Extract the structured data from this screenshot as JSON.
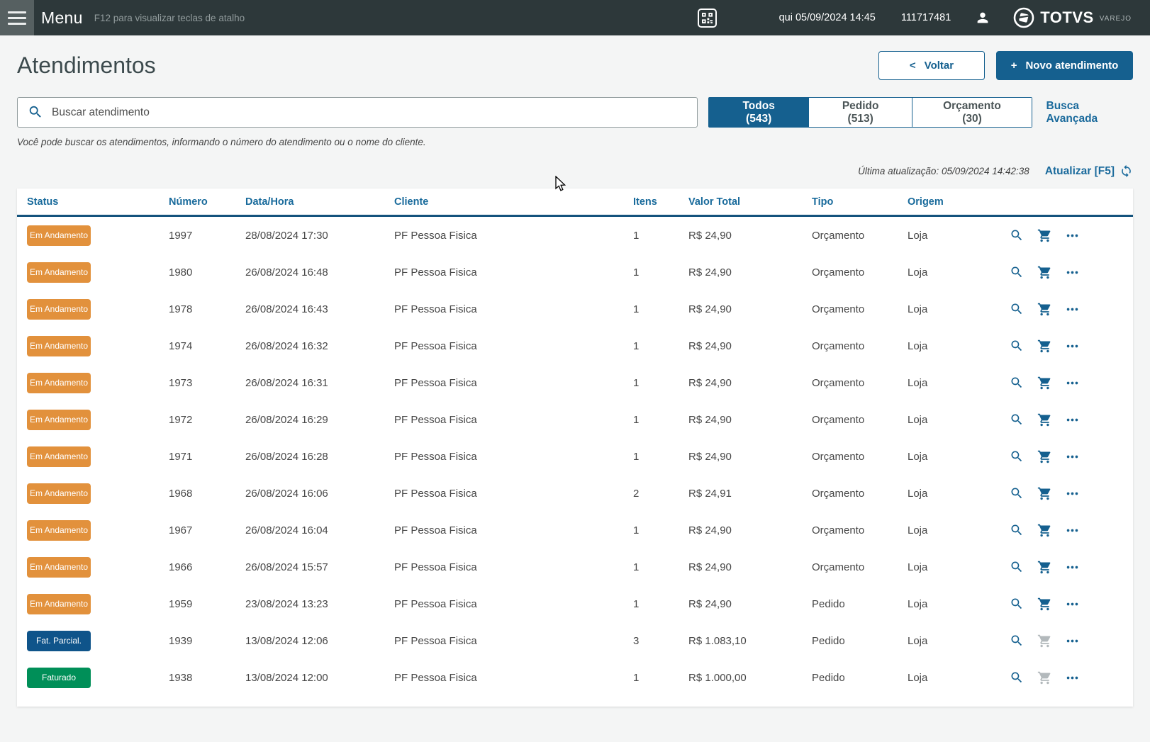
{
  "topbar": {
    "menu_label": "Menu",
    "shortcut_hint": "F12 para visualizar teclas de atalho",
    "datetime": "qui 05/09/2024 14:45",
    "user_code": "111717481",
    "brand": "TOTVS",
    "brand_sub": "VAREJO"
  },
  "header": {
    "title": "Atendimentos",
    "back_icon": "<",
    "back_label": "Voltar",
    "new_icon": "+",
    "new_label": "Novo atendimento"
  },
  "search": {
    "placeholder": "Buscar atendimento",
    "help_text": "Você pode buscar os atendimentos, informando o número do atendimento ou o nome do cliente."
  },
  "tabs": [
    {
      "slug": "todos",
      "label": "Todos (543)",
      "active": true
    },
    {
      "slug": "pedido",
      "label": "Pedido (513)",
      "active": false
    },
    {
      "slug": "orcamento",
      "label": "Orçamento (30)",
      "active": false
    }
  ],
  "advanced_search_label": "Busca Avançada",
  "refresh": {
    "last_update": "Última atualização: 05/09/2024 14:42:38",
    "refresh_label": "Atualizar [F5]"
  },
  "table": {
    "columns": [
      "Status",
      "Número",
      "Data/Hora",
      "Cliente",
      "Itens",
      "Valor Total",
      "Tipo",
      "Origem"
    ],
    "rows": [
      {
        "status": "Em Andamento",
        "badge": "orange",
        "numero": "1997",
        "datahora": "28/08/2024 17:30",
        "cliente": "PF Pessoa Fisica",
        "itens": "1",
        "valor": "R$ 24,90",
        "tipo": "Orçamento",
        "origem": "Loja",
        "cart_enabled": true
      },
      {
        "status": "Em Andamento",
        "badge": "orange",
        "numero": "1980",
        "datahora": "26/08/2024 16:48",
        "cliente": "PF Pessoa Fisica",
        "itens": "1",
        "valor": "R$ 24,90",
        "tipo": "Orçamento",
        "origem": "Loja",
        "cart_enabled": true
      },
      {
        "status": "Em Andamento",
        "badge": "orange",
        "numero": "1978",
        "datahora": "26/08/2024 16:43",
        "cliente": "PF Pessoa Fisica",
        "itens": "1",
        "valor": "R$ 24,90",
        "tipo": "Orçamento",
        "origem": "Loja",
        "cart_enabled": true
      },
      {
        "status": "Em Andamento",
        "badge": "orange",
        "numero": "1974",
        "datahora": "26/08/2024 16:32",
        "cliente": "PF Pessoa Fisica",
        "itens": "1",
        "valor": "R$ 24,90",
        "tipo": "Orçamento",
        "origem": "Loja",
        "cart_enabled": true
      },
      {
        "status": "Em Andamento",
        "badge": "orange",
        "numero": "1973",
        "datahora": "26/08/2024 16:31",
        "cliente": "PF Pessoa Fisica",
        "itens": "1",
        "valor": "R$ 24,90",
        "tipo": "Orçamento",
        "origem": "Loja",
        "cart_enabled": true
      },
      {
        "status": "Em Andamento",
        "badge": "orange",
        "numero": "1972",
        "datahora": "26/08/2024 16:29",
        "cliente": "PF Pessoa Fisica",
        "itens": "1",
        "valor": "R$ 24,90",
        "tipo": "Orçamento",
        "origem": "Loja",
        "cart_enabled": true
      },
      {
        "status": "Em Andamento",
        "badge": "orange",
        "numero": "1971",
        "datahora": "26/08/2024 16:28",
        "cliente": "PF Pessoa Fisica",
        "itens": "1",
        "valor": "R$ 24,90",
        "tipo": "Orçamento",
        "origem": "Loja",
        "cart_enabled": true
      },
      {
        "status": "Em Andamento",
        "badge": "orange",
        "numero": "1968",
        "datahora": "26/08/2024 16:06",
        "cliente": "PF Pessoa Fisica",
        "itens": "2",
        "valor": "R$ 24,91",
        "tipo": "Orçamento",
        "origem": "Loja",
        "cart_enabled": true
      },
      {
        "status": "Em Andamento",
        "badge": "orange",
        "numero": "1967",
        "datahora": "26/08/2024 16:04",
        "cliente": "PF Pessoa Fisica",
        "itens": "1",
        "valor": "R$ 24,90",
        "tipo": "Orçamento",
        "origem": "Loja",
        "cart_enabled": true
      },
      {
        "status": "Em Andamento",
        "badge": "orange",
        "numero": "1966",
        "datahora": "26/08/2024 15:57",
        "cliente": "PF Pessoa Fisica",
        "itens": "1",
        "valor": "R$ 24,90",
        "tipo": "Orçamento",
        "origem": "Loja",
        "cart_enabled": true
      },
      {
        "status": "Em Andamento",
        "badge": "orange",
        "numero": "1959",
        "datahora": "23/08/2024 13:23",
        "cliente": "PF Pessoa Fisica",
        "itens": "1",
        "valor": "R$ 24,90",
        "tipo": "Pedido",
        "origem": "Loja",
        "cart_enabled": true
      },
      {
        "status": "Fat. Parcial.",
        "badge": "blue",
        "numero": "1939",
        "datahora": "13/08/2024 12:06",
        "cliente": "PF Pessoa Fisica",
        "itens": "3",
        "valor": "R$ 1.083,10",
        "tipo": "Pedido",
        "origem": "Loja",
        "cart_enabled": false
      },
      {
        "status": "Faturado",
        "badge": "green",
        "numero": "1938",
        "datahora": "13/08/2024 12:00",
        "cliente": "PF Pessoa Fisica",
        "itens": "1",
        "valor": "R$ 1.000,00",
        "tipo": "Pedido",
        "origem": "Loja",
        "cart_enabled": false
      }
    ]
  },
  "colors": {
    "primary_blue": "#15608f",
    "link_blue": "#1a6a9c",
    "badge_orange": "#e2913c",
    "badge_dark_blue": "#0f548a",
    "badge_green": "#008f58",
    "topbar_bg": "#2d383a"
  }
}
